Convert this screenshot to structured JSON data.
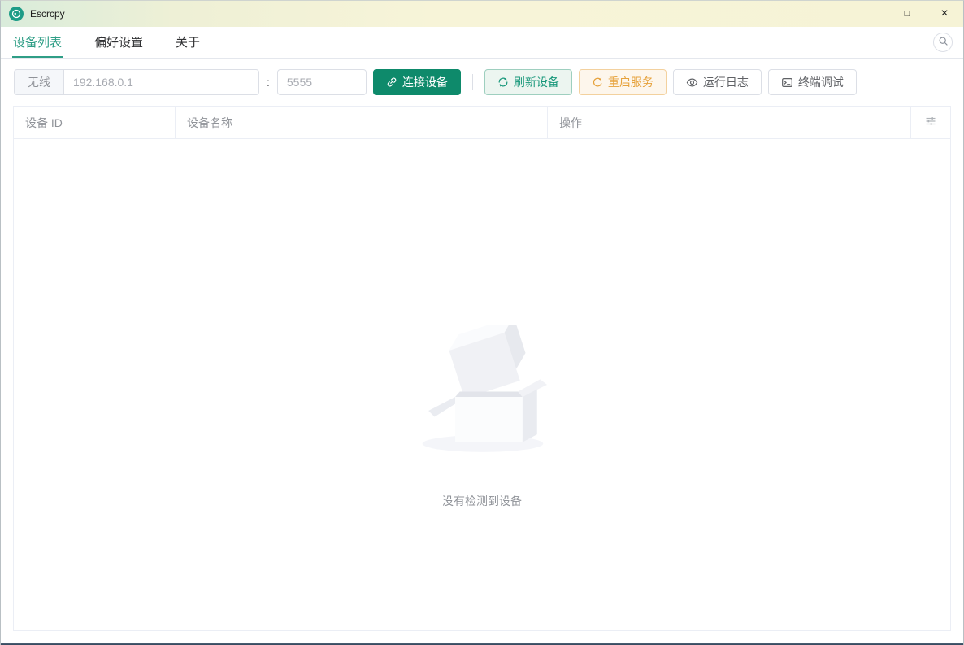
{
  "window": {
    "title": "Escrcpy",
    "controls": {
      "minimize": "—",
      "maximize": "□",
      "close": "×"
    }
  },
  "tabs": [
    {
      "label": "设备列表",
      "active": true
    },
    {
      "label": "偏好设置",
      "active": false
    },
    {
      "label": "关于",
      "active": false
    }
  ],
  "toolbar": {
    "wireless_label": "无线",
    "ip_placeholder": "192.168.0.1",
    "port_separator": ":",
    "port_placeholder": "5555",
    "connect_button": "连接设备",
    "refresh_button": "刷新设备",
    "restart_button": "重启服务",
    "logs_button": "运行日志",
    "terminal_button": "终端调试"
  },
  "device_table": {
    "columns": [
      {
        "label": "设备 ID"
      },
      {
        "label": "设备名称"
      },
      {
        "label": "操作"
      }
    ],
    "rows": [],
    "empty_text": "没有检测到设备"
  },
  "icons": {
    "app": "escrcpy-logo",
    "connect": "link-icon",
    "refresh": "refresh-icon",
    "restart": "refresh-right-icon",
    "logs": "view-eye-icon",
    "terminal": "terminal-icon",
    "search": "search-icon",
    "column_settings": "operation-sliders-icon",
    "empty_state": "empty-box-illustration"
  },
  "colors": {
    "primary_button": "#0e8a6b",
    "tab_active": "#2f9e86",
    "plain_green_bg": "#ecf5f0",
    "plain_green_border": "#9ecfbf",
    "warning_text": "#e6a23c",
    "warning_bg": "#fdf6ec",
    "warning_border": "#f3d19e",
    "default_border": "#dcdfe6",
    "table_border": "#ebeef5",
    "header_text": "#909399",
    "placeholder_text": "#a8abb2",
    "titlebar_gradient_start": "#d9ecdb",
    "titlebar_gradient_end": "#f6f3d6"
  }
}
